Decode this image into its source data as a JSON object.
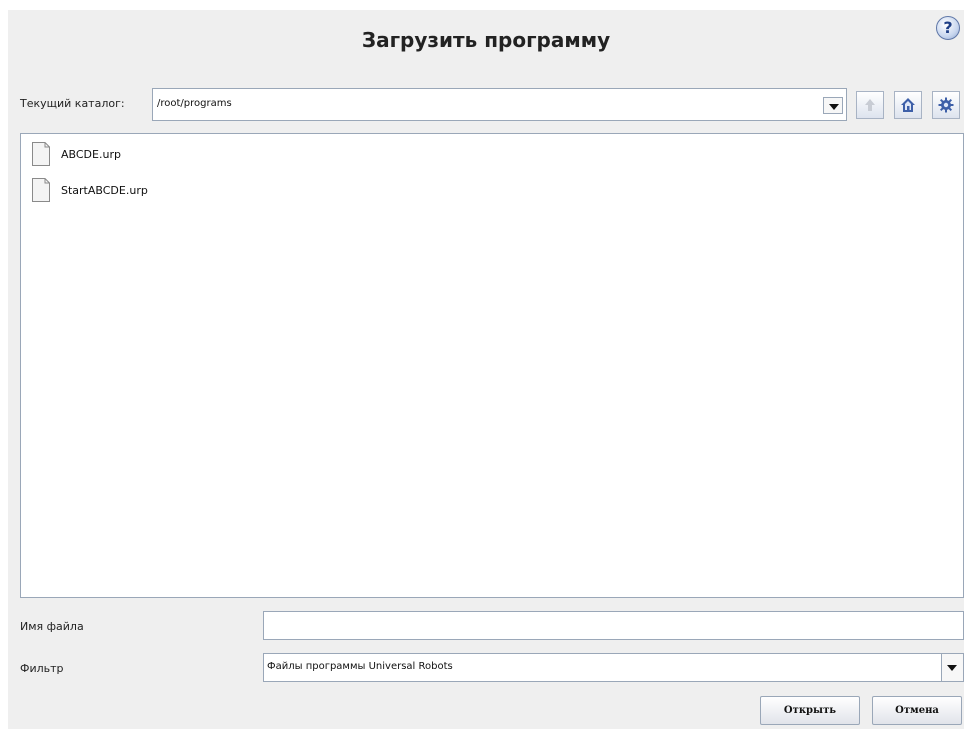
{
  "dialog": {
    "title": "Загрузить программу",
    "help_label": "?"
  },
  "directory": {
    "label": "Текущий каталог:",
    "value": "/root/programs"
  },
  "toolbar": {
    "icons": [
      "up-arrow-icon",
      "home-icon",
      "gear-icon"
    ]
  },
  "files": [
    {
      "name": "ABCDE.urp",
      "icon": "document-icon"
    },
    {
      "name": "StartABCDE.urp",
      "icon": "document-icon"
    }
  ],
  "filename": {
    "label": "Имя файла",
    "value": ""
  },
  "filter": {
    "label": "Фильтр",
    "selected": "Файлы программы Universal Robots"
  },
  "buttons": {
    "open": "Открыть",
    "cancel": "Отмена"
  },
  "colors": {
    "dialog_bg": "#efefef",
    "border": "#9aa7b8",
    "icon_blue": "#3d5fa8"
  }
}
